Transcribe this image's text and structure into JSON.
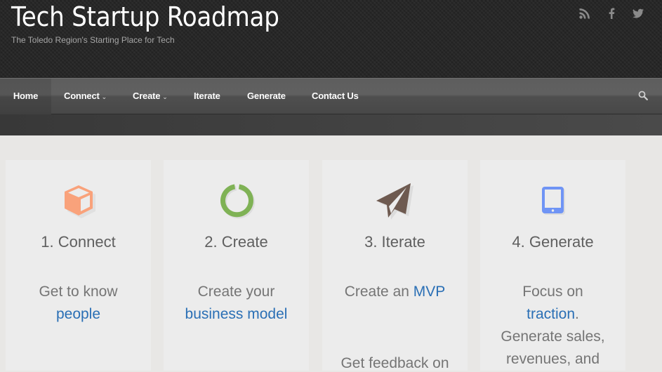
{
  "header": {
    "site_title": "Tech Startup Roadmap",
    "tagline": "The Toledo Region's Starting Place for Tech",
    "social": [
      {
        "name": "rss-icon"
      },
      {
        "name": "facebook-icon"
      },
      {
        "name": "twitter-icon"
      }
    ]
  },
  "nav": {
    "items": [
      {
        "label": "Home",
        "active": true,
        "dropdown": false
      },
      {
        "label": "Connect",
        "dropdown": true
      },
      {
        "label": "Create",
        "dropdown": true
      },
      {
        "label": "Iterate",
        "dropdown": false
      },
      {
        "label": "Generate",
        "dropdown": false
      },
      {
        "label": "Contact Us",
        "dropdown": false
      }
    ],
    "caret": "⌄",
    "search_icon": "search-icon"
  },
  "cards": [
    {
      "title": "1. Connect",
      "icon": "cube-icon",
      "icon_color": "#f9a27b",
      "text_before": "Get to know",
      "link": "people",
      "text_after": ""
    },
    {
      "title": "2. Create",
      "icon": "power-ring-icon",
      "icon_color": "#7fb255",
      "text_before": "Create your",
      "link": "business model",
      "text_after": ""
    },
    {
      "title": "3. Iterate",
      "icon": "paper-plane-icon",
      "icon_color": "#6e5a50",
      "text_before": "Create an",
      "link": "MVP",
      "text_after": "",
      "lower_text": "Get feedback on"
    },
    {
      "title": "4. Generate",
      "icon": "tablet-icon",
      "icon_color": "#6f94f5",
      "text_before": "Focus on",
      "link": "traction",
      "text_after": ". Generate sales, revenues, and"
    }
  ],
  "colors": {
    "link": "#2a6fb5",
    "header_bg": "#252525",
    "page_bg": "#e8e7e5"
  }
}
